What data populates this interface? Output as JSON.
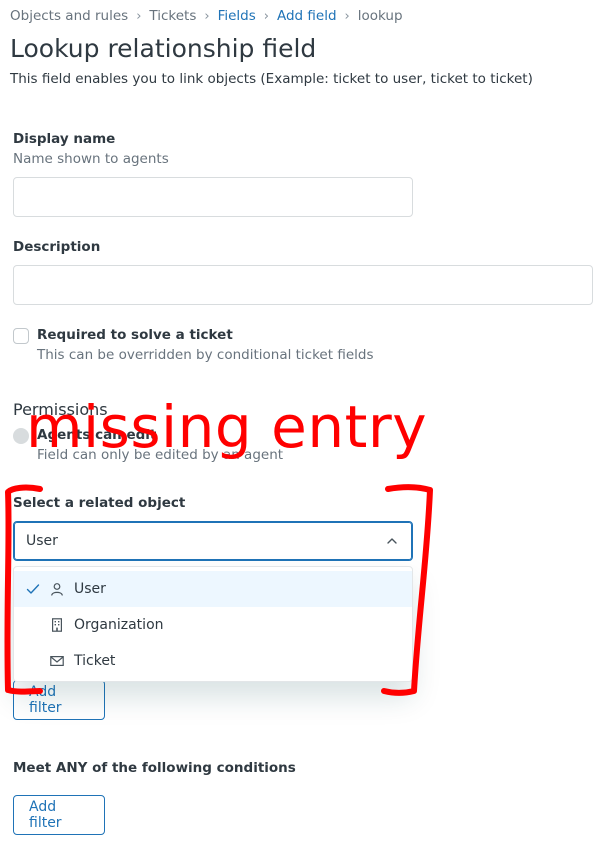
{
  "breadcrumb": [
    {
      "label": "Objects and rules",
      "link": false
    },
    {
      "label": "Tickets",
      "link": false
    },
    {
      "label": "Fields",
      "link": true
    },
    {
      "label": "Add field",
      "link": true
    },
    {
      "label": "lookup",
      "link": false
    }
  ],
  "page": {
    "title": "Lookup relationship field",
    "subtitle": "This field enables you to link objects (Example: ticket to user, ticket to ticket)"
  },
  "form": {
    "display_name": {
      "label": "Display name",
      "hint": "Name shown to agents",
      "value": ""
    },
    "description": {
      "label": "Description",
      "value": ""
    },
    "required": {
      "label": "Required to solve a ticket",
      "hint": "This can be overridden by conditional ticket fields",
      "checked": false
    },
    "permissions": {
      "title": "Permissions",
      "option_label": "Agents can edit",
      "option_hint": "Field can only be edited by an agent"
    },
    "related_object": {
      "label": "Select a related object",
      "value": "User",
      "options": [
        {
          "label": "User",
          "icon": "user-icon",
          "selected": true
        },
        {
          "label": "Organization",
          "icon": "building-icon",
          "selected": false
        },
        {
          "label": "Ticket",
          "icon": "envelope-icon",
          "selected": false
        }
      ]
    },
    "filters_all": {
      "button": "Add filter"
    },
    "filters_any": {
      "title": "Meet ANY of the following conditions",
      "button": "Add filter"
    }
  },
  "annotation": {
    "text": "missing entry",
    "color": "#ff0000"
  },
  "colors": {
    "accent": "#1f73b7",
    "text": "#2f3941",
    "muted": "#68737d",
    "highlight": "#edf7ff"
  }
}
